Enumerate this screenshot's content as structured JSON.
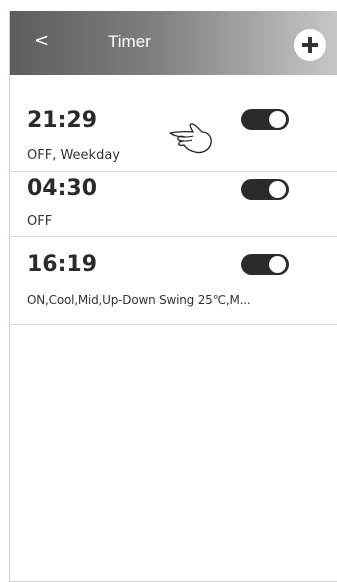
{
  "header": {
    "back_label": "<",
    "title": "Timer",
    "add_label": "+"
  },
  "timers": [
    {
      "time": "21:29",
      "description": "OFF, Weekday",
      "enabled": true
    },
    {
      "time": "04:30",
      "description": "OFF",
      "enabled": true
    },
    {
      "time": "16:19",
      "description": "ON,Cool,Mid,Up-Down Swing 25℃,M...",
      "enabled": true
    }
  ],
  "overlay": {
    "icon": "hand-pointer-icon"
  },
  "colors": {
    "header_dark": "#5a5e5c",
    "header_light": "#c6c8c6",
    "toggle_on": "#2b2b2b",
    "divider": "#cfdbd9"
  }
}
